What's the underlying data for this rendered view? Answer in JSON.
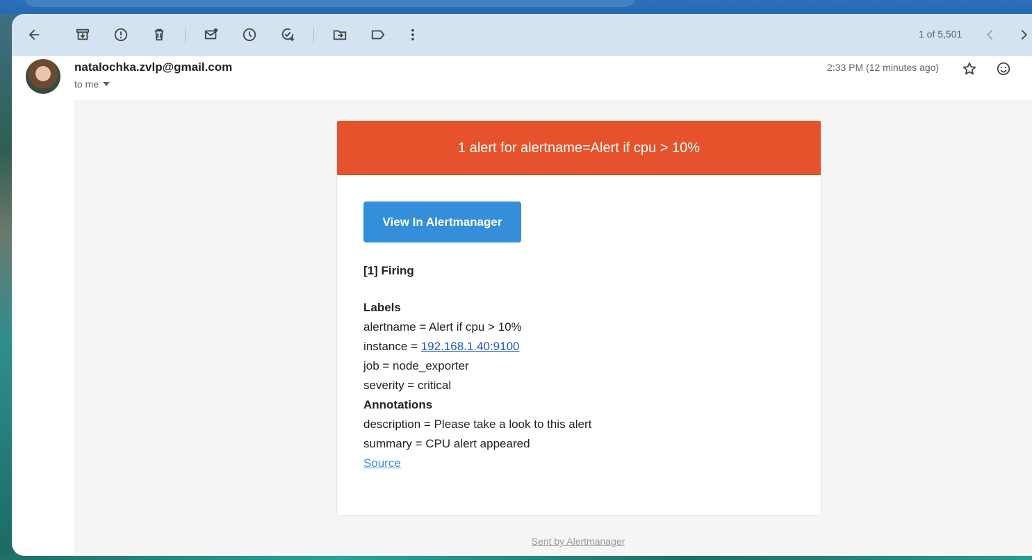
{
  "toolbar": {
    "back_icon": "arrow-left-icon",
    "archive_icon": "archive-icon",
    "spam_icon": "report-spam-icon",
    "delete_icon": "trash-icon",
    "unread_icon": "mark-unread-icon",
    "snooze_icon": "clock-icon",
    "task_icon": "add-task-icon",
    "move_icon": "move-to-folder-icon",
    "label_icon": "label-icon",
    "more_icon": "more-vertical-icon",
    "pager_text": "1 of 5,501",
    "prev_icon": "chevron-left-icon",
    "next_icon": "chevron-right-icon"
  },
  "message": {
    "sender_email": "natalochka.zvlp@gmail.com",
    "recipient": "to me",
    "timestamp": "2:33 PM (12 minutes ago)",
    "star_icon": "star-icon",
    "emoji_icon": "emoji-icon"
  },
  "alert": {
    "header": "1 alert for alertname=Alert if cpu > 10%",
    "button_label": "View In Alertmanager",
    "firing": "[1] Firing",
    "labels_heading": "Labels",
    "alertname_line": "alertname = Alert if cpu > 10%",
    "instance_prefix": "instance = ",
    "instance_value": "192.168.1.40:9100",
    "job_line": "job = node_exporter",
    "severity_line": "severity = critical",
    "annotations_heading": "Annotations",
    "description_line": "description = Please take a look to this alert",
    "summary_line": "summary = CPU alert appeared",
    "source_link": "Source"
  },
  "footer": {
    "prefix": "Sent by ",
    "link": "Alertmanager"
  },
  "colors": {
    "header_bg": "#e6522c",
    "button_bg": "#348eda",
    "toolbar_bg": "#d3e3f1",
    "body_bg": "#f5f5f5"
  }
}
